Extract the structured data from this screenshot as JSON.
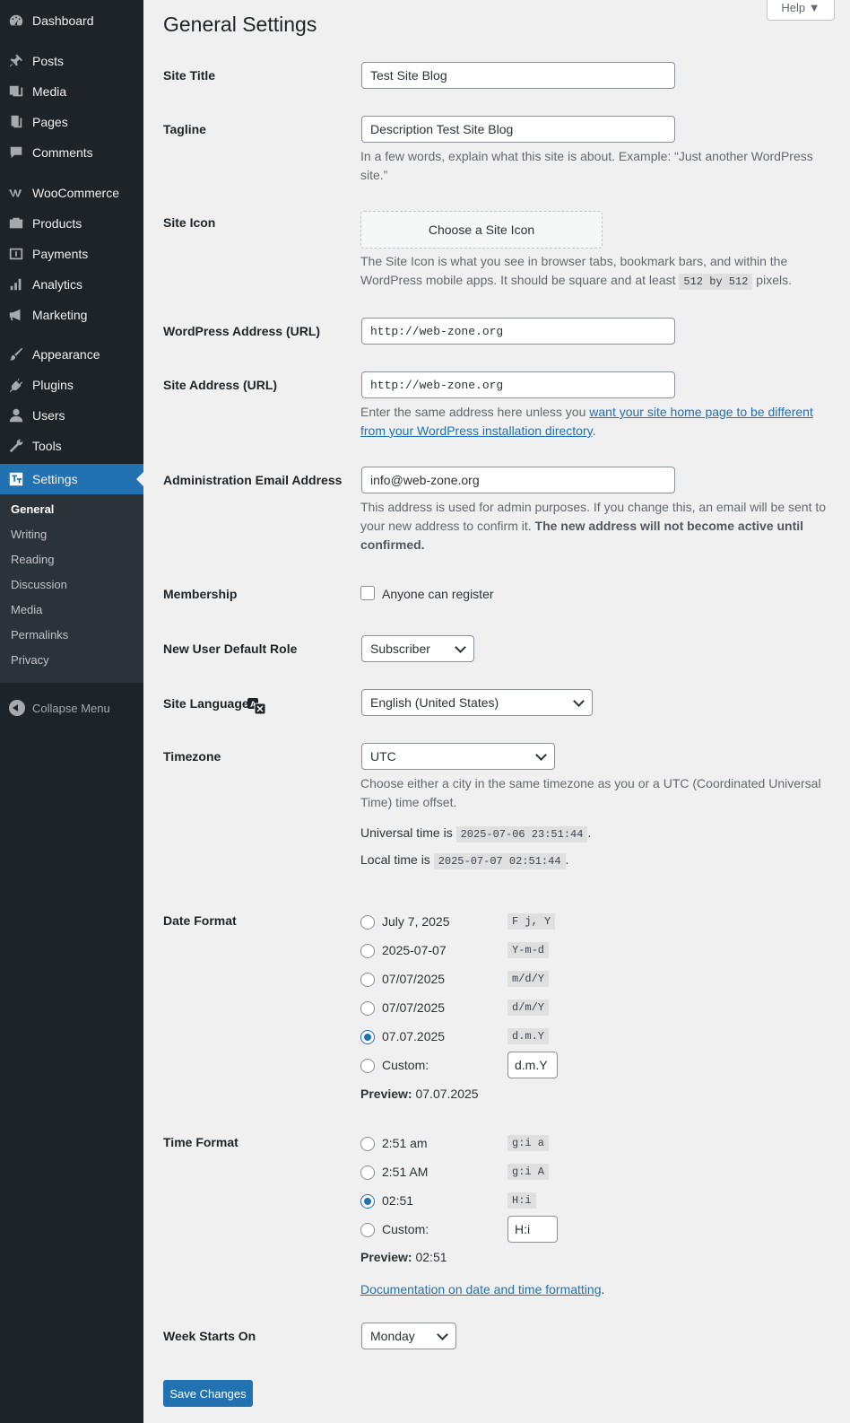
{
  "sidebar": {
    "items": [
      {
        "label": "Dashboard",
        "icon": "dashboard-icon"
      },
      {
        "label": "Posts",
        "icon": "pin-icon"
      },
      {
        "label": "Media",
        "icon": "media-icon"
      },
      {
        "label": "Pages",
        "icon": "pages-icon"
      },
      {
        "label": "Comments",
        "icon": "comments-icon"
      },
      {
        "label": "WooCommerce",
        "icon": "woocommerce-icon"
      },
      {
        "label": "Products",
        "icon": "products-icon"
      },
      {
        "label": "Payments",
        "icon": "payments-icon"
      },
      {
        "label": "Analytics",
        "icon": "analytics-icon"
      },
      {
        "label": "Marketing",
        "icon": "megaphone-icon"
      },
      {
        "label": "Appearance",
        "icon": "brush-icon"
      },
      {
        "label": "Plugins",
        "icon": "plugin-icon"
      },
      {
        "label": "Users",
        "icon": "users-icon"
      },
      {
        "label": "Tools",
        "icon": "wrench-icon"
      },
      {
        "label": "Settings",
        "icon": "settings-icon"
      }
    ],
    "submenu": [
      "General",
      "Writing",
      "Reading",
      "Discussion",
      "Media",
      "Permalinks",
      "Privacy"
    ],
    "collapse_label": "Collapse Menu"
  },
  "header": {
    "title": "General Settings",
    "help_label": "Help ▼"
  },
  "fields": {
    "site_title": {
      "label": "Site Title",
      "value": "Test Site Blog"
    },
    "tagline": {
      "label": "Tagline",
      "value": "Description Test Site Blog",
      "desc": "In a few words, explain what this site is about. Example: “Just another WordPress site.”"
    },
    "site_icon": {
      "label": "Site Icon",
      "button": "Choose a Site Icon",
      "desc_1": "The Site Icon is what you see in browser tabs, bookmark bars, and within the WordPress mobile apps. It should be square and at least",
      "desc_code": "512 by 512",
      "desc_2": "pixels."
    },
    "wp_address": {
      "label": "WordPress Address (URL)",
      "value": "http://web-zone.org"
    },
    "site_address": {
      "label": "Site Address (URL)",
      "value": "http://web-zone.org",
      "desc_1": "Enter the same address here unless you",
      "desc_link": "want your site home page to be different from your WordPress installation directory",
      "desc_2": "."
    },
    "admin_email": {
      "label": "Administration Email Address",
      "value": "info@web-zone.org",
      "desc_1": "This address is used for admin purposes. If you change this, an email will be sent to your new address to confirm it.",
      "desc_bold": "The new address will not become active until confirmed."
    },
    "membership": {
      "label": "Membership",
      "checkbox_label": "Anyone can register"
    },
    "default_role": {
      "label": "New User Default Role",
      "value": "Subscriber"
    },
    "language": {
      "label": "Site Language",
      "value": "English (United States)"
    },
    "timezone": {
      "label": "Timezone",
      "value": "UTC",
      "desc": "Choose either a city in the same timezone as you or a UTC (Coordinated Universal Time) time offset.",
      "universal_label": "Universal time is",
      "universal_value": "2025-07-06 23:51:44",
      "local_label": "Local time is",
      "local_value": "2025-07-07 02:51:44",
      "period": "."
    },
    "date_format": {
      "label": "Date Format",
      "options": [
        {
          "label": "July 7, 2025",
          "code": "F j, Y"
        },
        {
          "label": "2025-07-07",
          "code": "Y-m-d"
        },
        {
          "label": "07/07/2025",
          "code": "m/d/Y"
        },
        {
          "label": "07/07/2025",
          "code": "d/m/Y"
        },
        {
          "label": "07.07.2025",
          "code": "d.m.Y"
        }
      ],
      "custom_label": "Custom:",
      "custom_value": "d.m.Y",
      "preview_label": "Preview:",
      "preview_value": "07.07.2025"
    },
    "time_format": {
      "label": "Time Format",
      "options": [
        {
          "label": "2:51 am",
          "code": "g:i a"
        },
        {
          "label": "2:51 AM",
          "code": "g:i A"
        },
        {
          "label": "02:51",
          "code": "H:i"
        }
      ],
      "custom_label": "Custom:",
      "custom_value": "H:i",
      "preview_label": "Preview:",
      "preview_value": "02:51",
      "doc_link": "Documentation on date and time formatting",
      "doc_period": "."
    },
    "week_start": {
      "label": "Week Starts On",
      "value": "Monday"
    }
  },
  "save_label": "Save Changes",
  "colors": {
    "accent": "#2271b1",
    "sidebar_bg": "#1d2327",
    "submenu_bg": "#2c3338",
    "page_bg": "#f0f0f1"
  }
}
